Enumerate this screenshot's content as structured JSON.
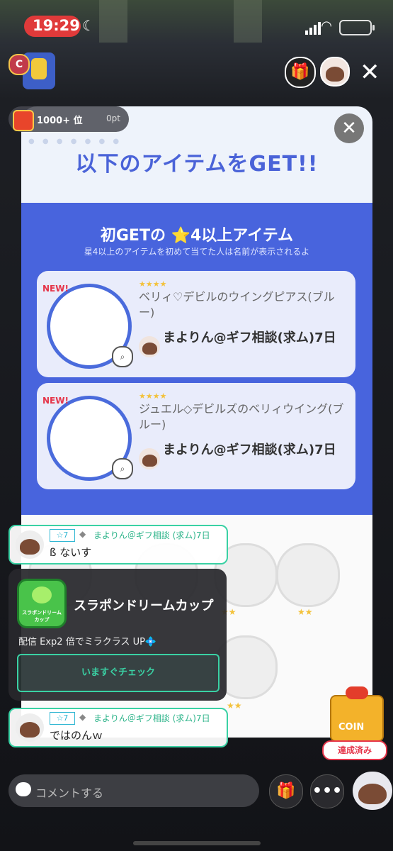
{
  "status_bar": {
    "time": "19:29"
  },
  "top_bar": {
    "rank_letter": "C"
  },
  "rank_pill": {
    "rank": "1000+ 位",
    "points": "0pt"
  },
  "modal": {
    "title": "以下のアイテムをGET!!",
    "close_label": "✕",
    "section_title": "初GETの ⭐4以上アイテム",
    "section_subtitle": "星4以上のアイテムを初めて当てた人は名前が表示されるよ",
    "new_label": "NEW!",
    "first_items": [
      {
        "stars": "★★★★",
        "name": "ベリィ♡デビルのウイングピアス(ブルー)",
        "owner": "まよりん@ギフ相談(求ム)7日"
      },
      {
        "stars": "★★★★",
        "name": "ジュエル◇デビルズのベリィウイング(ブルー)",
        "owner": "まよりん@ギフ相談(求ム)7日"
      }
    ],
    "grid_stars": "★★"
  },
  "chat": [
    {
      "level": "☆7",
      "username": "まよりん＠ギフ相談 (求ム)7日",
      "message": "ß ないす"
    },
    {
      "level": "☆7",
      "username": "まよりん＠ギフ相談 (求ム)7日",
      "message": "ではのんｗ"
    }
  ],
  "promo": {
    "icon_text": "スラポンドリーム カップ",
    "title": "スラポンドリームカップ",
    "description": "配信 Exp2 倍でミラクラス UP💠",
    "button_label": "いますぐチェック"
  },
  "coin_badge": {
    "label": "COIN",
    "achieved": "達成済み"
  },
  "bottom_bar": {
    "comment_placeholder": "コメントする",
    "more_label": "•••"
  },
  "colors": {
    "accent_blue": "#4864dd",
    "chat_border": "#3ad1a4",
    "new_red": "#e5354a",
    "star_gold": "#f3c23c"
  },
  "icons": [
    "moon-icon",
    "signal-icon",
    "wifi-icon",
    "battery-icon",
    "gift-icon",
    "close-icon",
    "zoom-icon",
    "comment-icon",
    "present-icon",
    "more-icon"
  ]
}
